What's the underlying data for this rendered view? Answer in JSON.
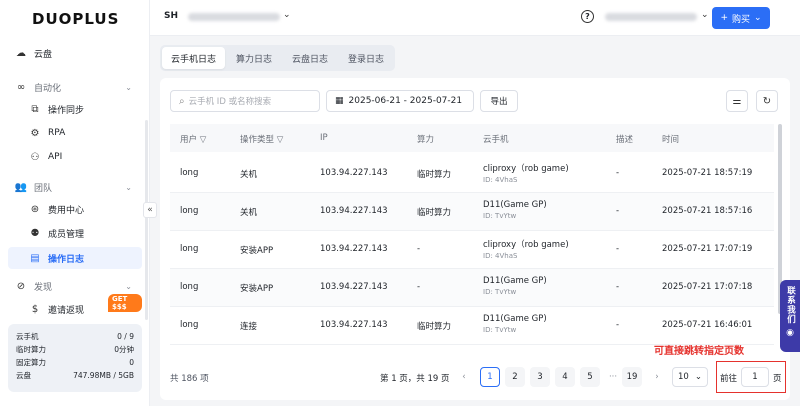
{
  "brand": {
    "logo_text": "DUOPLUS"
  },
  "sidebar": {
    "items": [
      {
        "label": "云盘",
        "icon": "cloud-icon"
      },
      {
        "label": "自动化",
        "icon": "infinity-icon",
        "group": true
      },
      {
        "label": "操作同步",
        "icon": "sync-icon"
      },
      {
        "label": "RPA",
        "icon": "robot-icon"
      },
      {
        "label": "API",
        "icon": "api-icon"
      },
      {
        "label": "团队",
        "icon": "team-icon",
        "group": true
      },
      {
        "label": "费用中心",
        "icon": "billing-icon"
      },
      {
        "label": "成员管理",
        "icon": "members-icon"
      },
      {
        "label": "操作日志",
        "icon": "log-icon",
        "active": true
      },
      {
        "label": "发现",
        "icon": "compass-icon",
        "group": true
      },
      {
        "label": "邀请返现",
        "icon": "dollar-icon"
      }
    ],
    "badge": "GET $$$",
    "collapse_glyph": "«",
    "stats": [
      {
        "label": "云手机",
        "value": "0 / 9"
      },
      {
        "label": "临时算力",
        "value": "0分钟"
      },
      {
        "label": "固定算力",
        "value": "0"
      },
      {
        "label": "云盘",
        "value": "747.98MB / 5GB"
      }
    ]
  },
  "header": {
    "workspace_avatar": "SH",
    "buy_label": "购买",
    "buy_plus": "+",
    "help_glyph": "?"
  },
  "tabs": [
    "云手机日志",
    "算力日志",
    "云盘日志",
    "登录日志"
  ],
  "toolbar": {
    "search_placeholder": "云手机 ID 或名称搜索",
    "date_range": "2025-06-21 - 2025-07-21",
    "export_label": "导出"
  },
  "table": {
    "headers": [
      "用户",
      "操作类型",
      "IP",
      "算力",
      "云手机",
      "描述",
      "时间"
    ],
    "rows": [
      {
        "user": "long",
        "action": "关机",
        "ip": "103.94.227.143",
        "compute": "临时算力",
        "phone": "cliproxy（rob game)",
        "phone_id": "ID: 4VhaS",
        "desc": "-",
        "time": "2025-07-21 18:57:19"
      },
      {
        "user": "long",
        "action": "关机",
        "ip": "103.94.227.143",
        "compute": "临时算力",
        "phone": "D11(Game GP)",
        "phone_id": "ID: TvYtw",
        "desc": "-",
        "time": "2025-07-21 18:57:16"
      },
      {
        "user": "long",
        "action": "安装APP",
        "ip": "103.94.227.143",
        "compute": "-",
        "phone": "cliproxy（rob game)",
        "phone_id": "ID: 4VhaS",
        "desc": "-",
        "time": "2025-07-21 17:07:19"
      },
      {
        "user": "long",
        "action": "安装APP",
        "ip": "103.94.227.143",
        "compute": "-",
        "phone": "D11(Game GP)",
        "phone_id": "ID: TvYtw",
        "desc": "-",
        "time": "2025-07-21 17:07:18"
      },
      {
        "user": "long",
        "action": "连接",
        "ip": "103.94.227.143",
        "compute": "临时算力",
        "phone": "D11(Game GP)",
        "phone_id": "ID: TvYtw",
        "desc": "-",
        "time": "2025-07-21 16:46:01"
      }
    ]
  },
  "pagination": {
    "total": "共 186 项",
    "page_info": "第 1 页，共 19 页",
    "pages": [
      "1",
      "2",
      "3",
      "4",
      "5",
      "···",
      "19"
    ],
    "page_size": "10",
    "goto_label": "前往",
    "goto_value": "1",
    "goto_unit": "页"
  },
  "annotation": "可直接跳转指定页数",
  "contact": {
    "label": "联系我们"
  },
  "colors": {
    "accent": "#2b6ef6",
    "annotation": "#e5322d",
    "contact_bg": "#3d3aa8",
    "badge": "#ff7a1a"
  }
}
